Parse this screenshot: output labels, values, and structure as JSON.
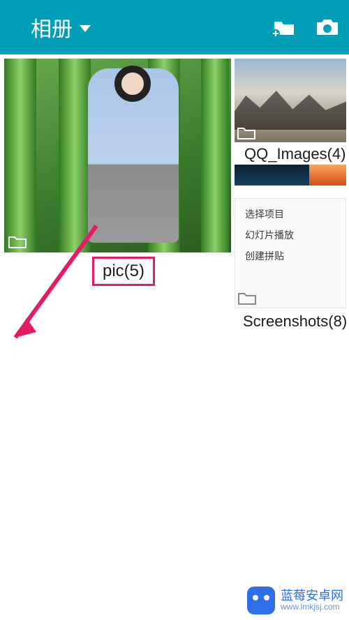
{
  "header": {
    "title": "相册"
  },
  "albums": {
    "pic": {
      "label": "pic(5)"
    },
    "qq": {
      "label": "QQ_Images(4)"
    },
    "screenshots": {
      "label": "Screenshots(8)",
      "menu": {
        "select": "选择项目",
        "slideshow": "幻灯片播放",
        "collage": "创建拼贴"
      }
    }
  },
  "watermark": {
    "name": "蓝莓安卓网",
    "url": "www.lmkjsj.com"
  }
}
